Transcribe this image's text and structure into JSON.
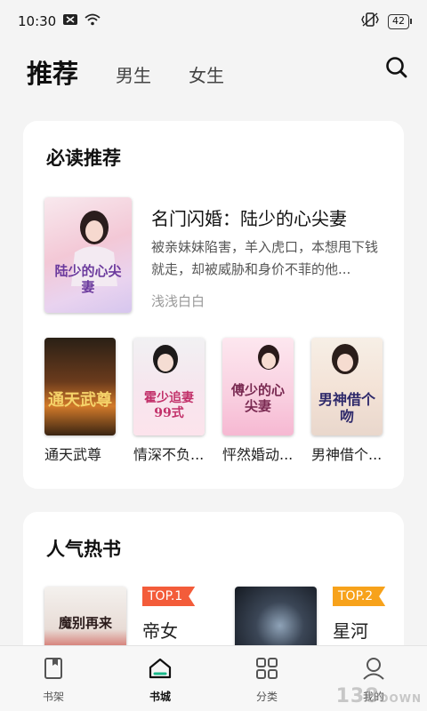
{
  "status_bar": {
    "time": "10:30",
    "battery": "42"
  },
  "tabs": [
    {
      "label": "推荐",
      "active": true
    },
    {
      "label": "男生",
      "active": false
    },
    {
      "label": "女生",
      "active": false
    }
  ],
  "must_read": {
    "title": "必读推荐",
    "featured": {
      "title": "名门闪婚：陆少的心尖妻",
      "description": "被亲妹妹陷害，羊入虎口，本想甩下钱就走，却被威胁和身价不菲的他...",
      "author": "浅浅白白",
      "cover_text": "陆少的心尖妻"
    },
    "books": [
      {
        "title": "通天武尊",
        "cover_text": "通天武尊"
      },
      {
        "title": "情深不负...",
        "cover_text": "霍少追妻99式"
      },
      {
        "title": "怦然婚动...",
        "cover_text": "傅少的心尖妻"
      },
      {
        "title": "男神借个...",
        "cover_text": "男神借个吻"
      }
    ]
  },
  "hot_books": {
    "title": "人气热书",
    "items": [
      {
        "rank": "TOP.1",
        "title": "帝女",
        "cover_text": "魔别再来"
      },
      {
        "rank": "TOP.2",
        "title": "星河",
        "cover_text": ""
      }
    ]
  },
  "bottom_nav": [
    {
      "label": "书架",
      "icon": "bookshelf-icon"
    },
    {
      "label": "书城",
      "icon": "bookstore-icon",
      "active": true
    },
    {
      "label": "分类",
      "icon": "category-icon"
    },
    {
      "label": "我的",
      "icon": "profile-icon"
    }
  ],
  "watermark": {
    "number": "138",
    "text": "DOWN"
  },
  "colors": {
    "rank1": "#f35c3a",
    "rank2": "#f7a21b",
    "accent": "#111111"
  }
}
